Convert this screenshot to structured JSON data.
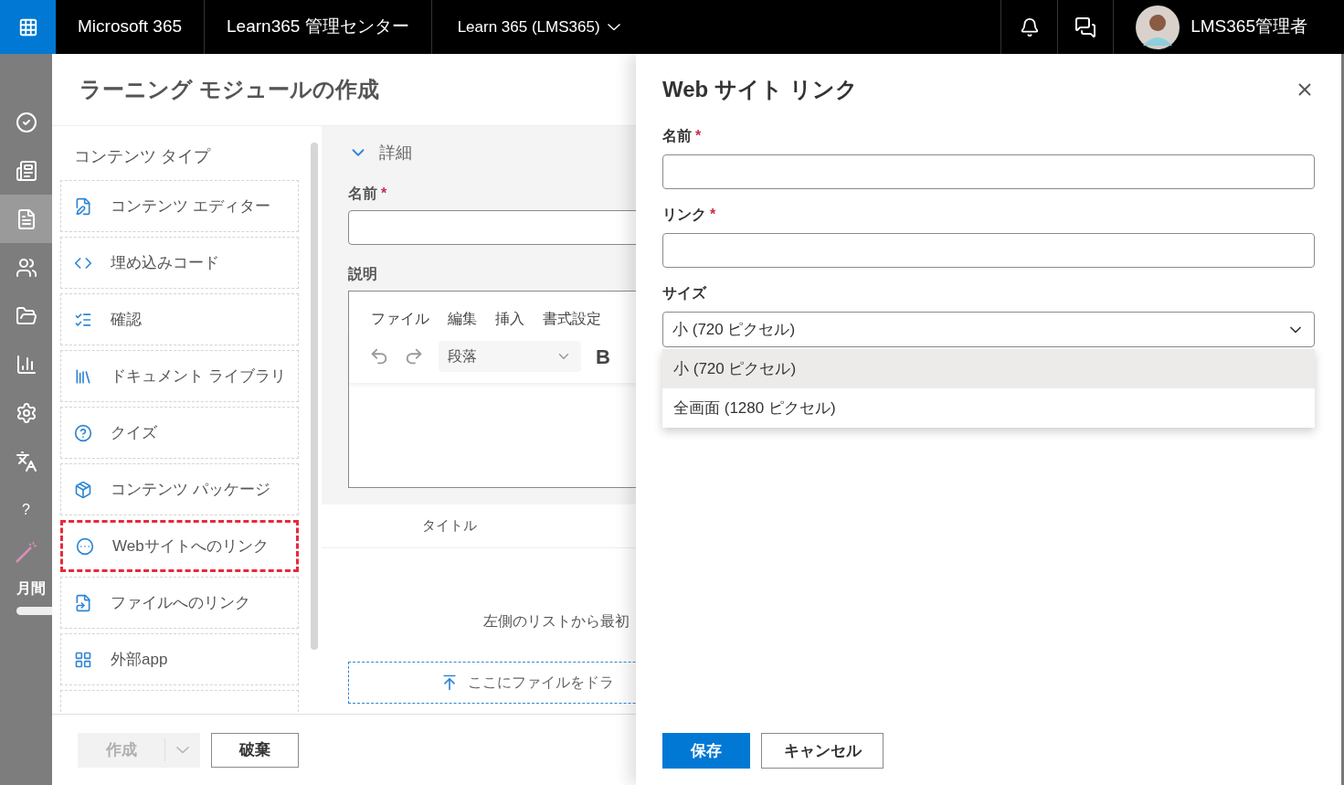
{
  "top_bar": {
    "app_name": "Microsoft 365",
    "center_name": "Learn365 管理センター",
    "tenant": "Learn 365 (LMS365)",
    "user_name": "LMS365管理者"
  },
  "rail": {
    "items": [
      {
        "kind": "check",
        "selected": false
      },
      {
        "kind": "news",
        "selected": false
      },
      {
        "kind": "document",
        "selected": true
      },
      {
        "kind": "people",
        "selected": false
      },
      {
        "kind": "folder",
        "selected": false
      },
      {
        "kind": "chart",
        "selected": false
      },
      {
        "kind": "settings",
        "selected": false
      },
      {
        "kind": "language",
        "selected": false
      },
      {
        "kind": "help",
        "label": "?",
        "selected": false
      }
    ],
    "usage_label": "月間"
  },
  "module_panel": {
    "title": "ラーニング モジュールの作成",
    "content_types": {
      "title": "コンテンツ タイプ",
      "items": [
        {
          "kind": "editor",
          "label": "コンテンツ エディター",
          "highlighted": false
        },
        {
          "kind": "code",
          "label": "埋め込みコード",
          "highlighted": false
        },
        {
          "kind": "confirm",
          "label": "確認",
          "highlighted": false
        },
        {
          "kind": "library",
          "label": "ドキュメント ライブラリ",
          "highlighted": false
        },
        {
          "kind": "quiz",
          "label": "クイズ",
          "highlighted": false
        },
        {
          "kind": "package",
          "label": "コンテンツ パッケージ",
          "highlighted": false
        },
        {
          "kind": "web",
          "label": "Webサイトへのリンク",
          "highlighted": true
        },
        {
          "kind": "file",
          "label": "ファイルへのリンク",
          "highlighted": false
        },
        {
          "kind": "app",
          "label": "外部app",
          "highlighted": false
        }
      ]
    },
    "required_mark": "*",
    "details": {
      "title": "詳細",
      "expanded": true,
      "name_label": "名前",
      "name_required": true,
      "description_label": "説明",
      "editor_menu": [
        "ファイル",
        "編集",
        "挿入",
        "書式設定"
      ],
      "block_format": "段落",
      "bold_label": "B"
    },
    "table_column": "タイトル",
    "empty_message": "左側のリストから最初",
    "dropzone": "ここにファイルをドラ",
    "create_button": {
      "label": "作成",
      "disabled": true
    },
    "discard_button": "破棄"
  },
  "link_panel": {
    "title": "Web サイト リンク",
    "fields": [
      {
        "kind": "text",
        "label": "名前",
        "required": true
      },
      {
        "kind": "text",
        "label": "リンク",
        "required": true
      },
      {
        "kind": "select",
        "label": "サイズ",
        "required": false,
        "value": "小 (720 ピクセル)",
        "expanded": true,
        "options": [
          {
            "label": "小 (720 ピクセル)",
            "selected": true
          },
          {
            "label": "全画面 (1280 ピクセル)",
            "selected": false
          }
        ]
      }
    ],
    "save_button": "保存",
    "cancel_button": "キャンセル"
  }
}
